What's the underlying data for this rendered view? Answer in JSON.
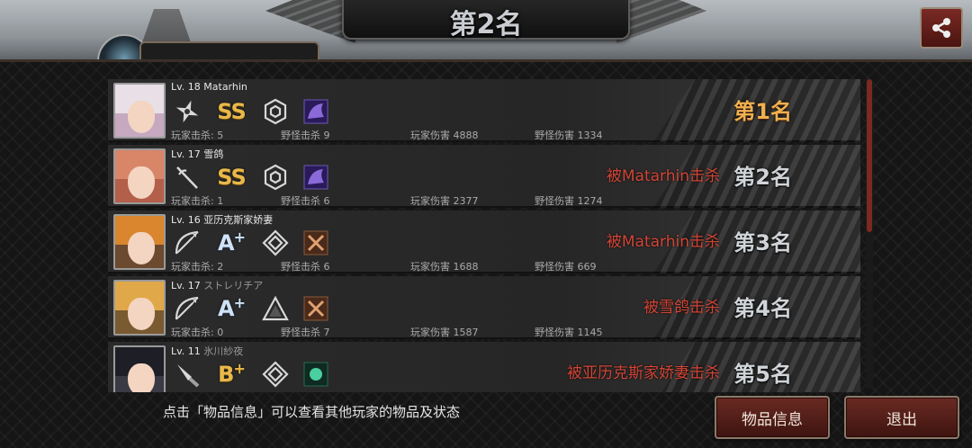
{
  "header": {
    "title": "第2名",
    "left_tab_label": ""
  },
  "colors": {
    "accent_red": "#d24536",
    "gold_rank": "#f0b050",
    "button_bg": "#6a2a22"
  },
  "players": [
    {
      "level_name": "Lv. 18 Matarhin",
      "jp_name": "",
      "weapon_icon": "shuriken-icon",
      "grade": "SS",
      "grade_style": "gold",
      "emblem_icon": "hexagon-emblem-icon",
      "item_icon": "purple-beast-icon",
      "player_kills": "玩家击杀: 5",
      "monster_kills": "野怪击杀 9",
      "player_damage": "玩家伤害 4888",
      "monster_damage": "野怪伤害 1334",
      "killed_by": "",
      "rank": "第1名",
      "rank_style": "gold",
      "hair_color": "#e8e0e6",
      "bg_color": "#c6a9c0"
    },
    {
      "level_name": "Lv. 17 雪鸽",
      "jp_name": "",
      "weapon_icon": "rapier-icon",
      "grade": "SS",
      "grade_style": "gold",
      "emblem_icon": "hexagon-emblem-icon",
      "item_icon": "purple-beast-icon",
      "player_kills": "玩家击杀: 1",
      "monster_kills": "野怪击杀 6",
      "player_damage": "玩家伤害 2377",
      "monster_damage": "野怪伤害 1274",
      "killed_by": "被Matarhin击杀",
      "rank": "第2名",
      "rank_style": "silver",
      "hair_color": "#d98568",
      "bg_color": "#b45f4a"
    },
    {
      "level_name": "Lv. 16 亚历克斯家娇妻",
      "jp_name": "",
      "weapon_icon": "bow-icon",
      "grade": "A",
      "grade_sup": "+",
      "grade_style": "blue",
      "emblem_icon": "diamond-emblem-icon",
      "item_icon": "crossed-swords-icon",
      "player_kills": "玩家击杀: 2",
      "monster_kills": "野怪击杀 6",
      "player_damage": "玩家伤害 1688",
      "monster_damage": "野怪伤害 669",
      "killed_by": "被Matarhin击杀",
      "rank": "第3名",
      "rank_style": "silver",
      "hair_color": "#d9862e",
      "bg_color": "#6b4a30"
    },
    {
      "level_name": "Lv. 17",
      "jp_name": "ストレリチア",
      "weapon_icon": "bow-icon",
      "grade": "A",
      "grade_sup": "+",
      "grade_style": "blue",
      "emblem_icon": "triangle-emblem-icon",
      "item_icon": "crossed-swords-icon",
      "player_kills": "玩家击杀: 0",
      "monster_kills": "野怪击杀 7",
      "player_damage": "玩家伤害 1587",
      "monster_damage": "野怪伤害 1145",
      "killed_by": "被雪鸽击杀",
      "rank": "第4名",
      "rank_style": "silver",
      "hair_color": "#e0a848",
      "bg_color": "#7a5a30"
    },
    {
      "level_name": "Lv. 11",
      "jp_name": "氷川紗夜",
      "weapon_icon": "knife-icon",
      "grade": "B",
      "grade_sup": "+",
      "grade_style": "gold",
      "emblem_icon": "diamond-emblem-icon",
      "item_icon": "green-gem-icon",
      "player_kills": "",
      "monster_kills": "",
      "player_damage": "",
      "monster_damage": "",
      "killed_by": "被亚历克斯家娇妻击杀",
      "rank": "第5名",
      "rank_style": "silver",
      "hair_color": "#1e1e26",
      "bg_color": "#3a3a44"
    }
  ],
  "footer": {
    "hint": "点击「物品信息」可以查看其他玩家的物品及状态",
    "item_info_button": "物品信息",
    "exit_button": "退出"
  }
}
